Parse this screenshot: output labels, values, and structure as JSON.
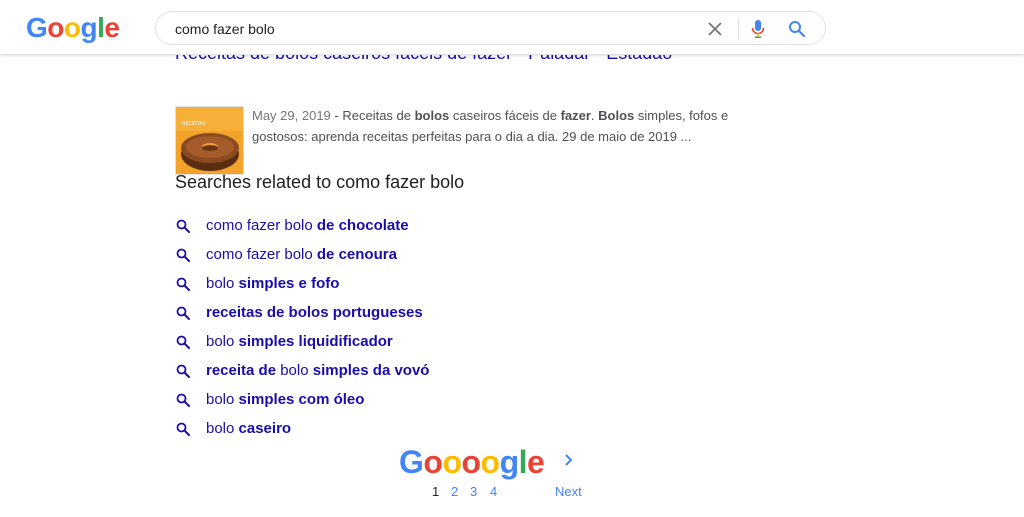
{
  "header": {
    "logo_letters": [
      "G",
      "o",
      "o",
      "g",
      "l",
      "e"
    ],
    "search": {
      "value": "como fazer bolo",
      "placeholder": ""
    },
    "icons": {
      "clear": "close-icon",
      "voice": "microphone-icon",
      "search": "search-icon"
    }
  },
  "result": {
    "title": "Receitas de bolos caseiros fáceis de fazer - Paladar - Estadão",
    "thumbnail_caption": "RECEITAS",
    "snippet": {
      "date": "May 29, 2019",
      "sep": " - ",
      "parts": [
        {
          "t": "Receitas de ",
          "b": false
        },
        {
          "t": "bolos",
          "b": true
        },
        {
          "t": " caseiros fáceis de ",
          "b": false
        },
        {
          "t": "fazer",
          "b": true
        },
        {
          "t": ". ",
          "b": false
        },
        {
          "t": "Bolos",
          "b": true
        },
        {
          "t": " simples, fofos e gostosos: aprenda receitas perfeitas para o dia a dia. 29 de maio de 2019 ...",
          "b": false
        }
      ]
    }
  },
  "related": {
    "heading": "Searches related to como fazer bolo",
    "items": [
      {
        "normal": "como fazer bolo ",
        "bold": "de chocolate",
        "suffix": ""
      },
      {
        "normal": "como fazer bolo ",
        "bold": "de cenoura",
        "suffix": ""
      },
      {
        "normal": "bolo ",
        "bold": "simples e fofo",
        "suffix": ""
      },
      {
        "normal": "",
        "bold": "receitas de bolos portugueses",
        "suffix": ""
      },
      {
        "normal": "bolo ",
        "bold": "simples liquidificador",
        "suffix": ""
      },
      {
        "prefix_bold": "receita de ",
        "normal": "bolo ",
        "bold": "simples da vovó",
        "suffix": ""
      },
      {
        "normal": "bolo ",
        "bold": "simples com óleo",
        "suffix": ""
      },
      {
        "normal": "bolo ",
        "bold": "caseiro",
        "suffix": ""
      }
    ]
  },
  "pagination": {
    "logo_letters": [
      "G",
      "o",
      "o",
      "o",
      "o",
      "g",
      "l",
      "e"
    ],
    "current": "1",
    "pages": [
      "2",
      "3",
      "4"
    ],
    "next_label": "Next"
  },
  "colors": {
    "google_blue": "#4285f4",
    "google_red": "#ea4335",
    "google_yellow": "#fbbc05",
    "google_green": "#34a853",
    "link": "#1a0dab"
  }
}
